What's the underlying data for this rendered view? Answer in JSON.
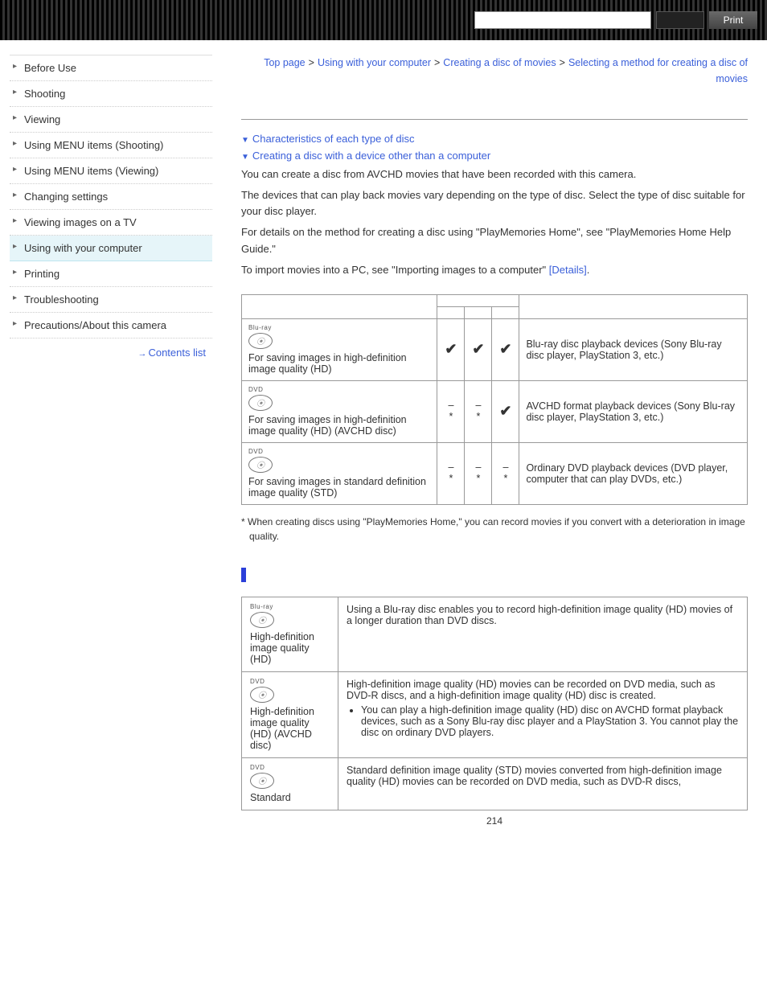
{
  "topbar": {
    "search_placeholder": "",
    "go_label": "",
    "print_label": "Print"
  },
  "sidebar": {
    "items": [
      {
        "label": "Before Use"
      },
      {
        "label": "Shooting"
      },
      {
        "label": "Viewing"
      },
      {
        "label": "Using MENU items (Shooting)"
      },
      {
        "label": "Using MENU items (Viewing)"
      },
      {
        "label": "Changing settings"
      },
      {
        "label": "Viewing images on a TV"
      },
      {
        "label": "Using with your computer"
      },
      {
        "label": "Printing"
      },
      {
        "label": "Troubleshooting"
      },
      {
        "label": "Precautions/About this camera"
      }
    ],
    "active_index": 7,
    "contents_link": "Contents list"
  },
  "breadcrumb": {
    "items": [
      {
        "label": "Top page"
      },
      {
        "label": "Using with your computer"
      },
      {
        "label": "Creating a disc of movies"
      },
      {
        "label": "Selecting a method for creating a disc of movies"
      }
    ]
  },
  "anchors": {
    "a1": "Characteristics of each type of disc",
    "a2": "Creating a disc with a device other than a computer"
  },
  "paras": {
    "p1": "You can create a disc from AVCHD movies that have been recorded with this camera.",
    "p2": "The devices that can play back movies vary depending on the type of disc. Select the type of disc suitable for your disc player.",
    "p3": "For details on the method for creating a disc using \"PlayMemories Home\", see \"PlayMemories Home Help Guide.\"",
    "p4_pre": "To import movies into a PC, see \"Importing images to a computer\" ",
    "p4_link": "[Details]",
    "p4_post": "."
  },
  "table1": {
    "check": "✔",
    "dash": "–",
    "star": "*",
    "rows": [
      {
        "ico_small": "Blu-ray",
        "desc": "For saving images in high-definition image quality (HD)",
        "cells": [
          "check",
          "check",
          "check"
        ],
        "player": "Blu-ray disc playback devices (Sony Blu-ray disc player, PlayStation 3, etc.)"
      },
      {
        "ico_small": "DVD",
        "desc": "For saving images in high-definition image quality (HD) (AVCHD disc)",
        "cells": [
          "dashstar",
          "dashstar",
          "check"
        ],
        "player": "AVCHD format playback devices (Sony Blu-ray disc player, PlayStation 3, etc.)"
      },
      {
        "ico_small": "DVD",
        "desc": "For saving images in standard definition image quality (STD)",
        "cells": [
          "dashstar",
          "dashstar",
          "dashstar"
        ],
        "player": "Ordinary DVD playback devices (DVD player, computer that can play DVDs, etc.)"
      }
    ]
  },
  "footnote": "* When creating discs using \"PlayMemories Home,\" you can record movies if you convert with a deterioration in image quality.",
  "table2": {
    "rows": [
      {
        "ico_small": "Blu-ray",
        "label": "High-definition image quality (HD)",
        "text": "Using a Blu-ray disc enables you to record high-definition image quality (HD) movies of a longer duration than DVD discs."
      },
      {
        "ico_small": "DVD",
        "label": "High-definition image quality (HD) (AVCHD disc)",
        "text": "High-definition image quality (HD) movies can be recorded on DVD media, such as DVD-R discs, and a high-definition image quality (HD) disc is created.",
        "bullet": "You can play a high-definition image quality (HD) disc on AVCHD format playback devices, such as a Sony Blu-ray disc player and a PlayStation 3. You cannot play the disc on ordinary DVD players."
      },
      {
        "ico_small": "DVD",
        "label": "Standard",
        "text": "Standard definition image quality (STD) movies converted from high-definition image quality (HD) movies can be recorded on DVD media, such as DVD-R discs,"
      }
    ]
  },
  "page_number": "214"
}
